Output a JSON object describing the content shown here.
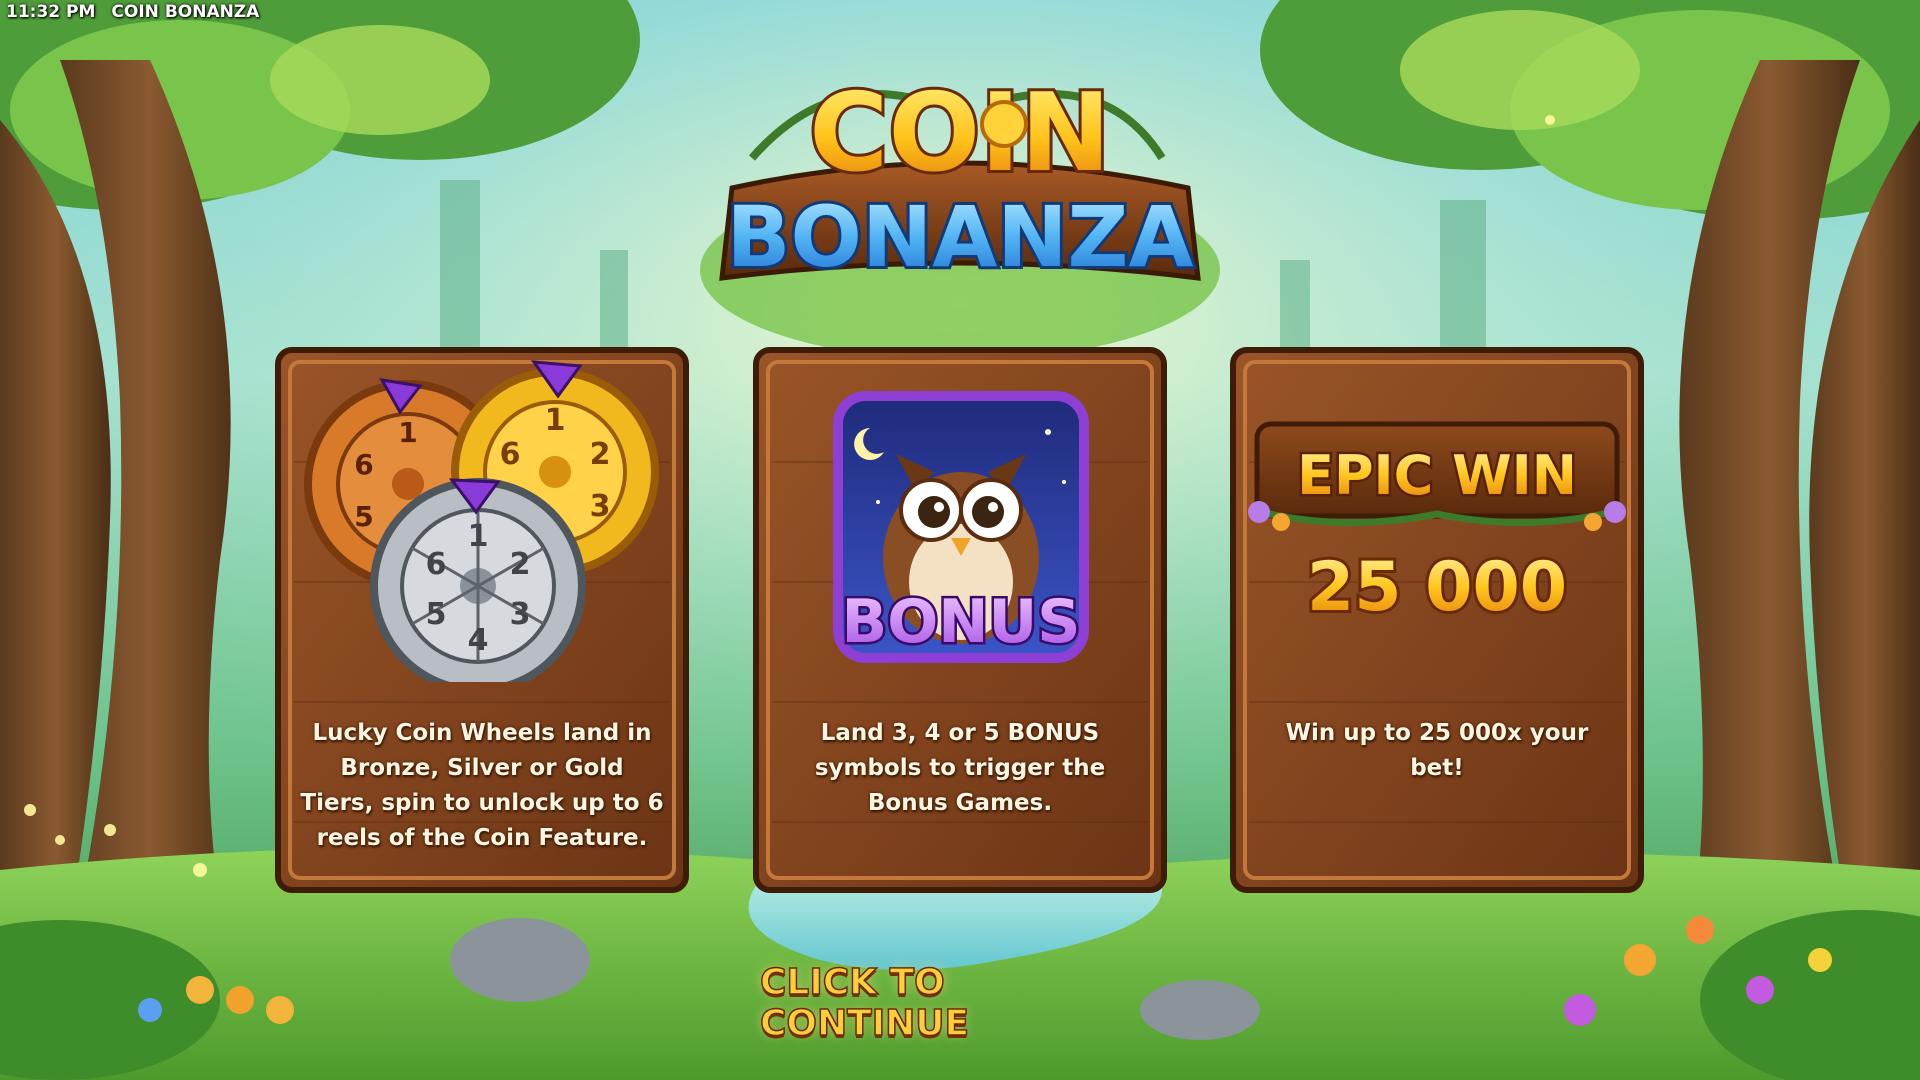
{
  "status_bar": {
    "time": "11:32 PM",
    "app_title": "COIN BONANZA"
  },
  "logo": {
    "line1": "COIN",
    "line2": "BONANZA"
  },
  "panels": [
    {
      "id": "wheels",
      "wheel_numbers": [
        "1",
        "2",
        "3",
        "4",
        "5",
        "6"
      ],
      "description": "Lucky Coin Wheels land in Bronze, Silver or Gold Tiers, spin to unlock up to 6 reels of the Coin Feature."
    },
    {
      "id": "bonus",
      "symbol_label": "BONUS",
      "description": "Land 3, 4 or 5 BONUS symbols to trigger the Bonus Games."
    },
    {
      "id": "epic",
      "banner_text": "EPIC WIN",
      "amount": "25 000",
      "description": "Win up to 25 000x your bet!"
    }
  ],
  "continue_label": "CLICK TO CONTINUE",
  "colors": {
    "wood": "#8a4a22",
    "wood_dark": "#5a2c10",
    "gold": "#ffcc33",
    "bonus_purple": "#8e3fd6",
    "logo_blue": "#4fb0f0"
  }
}
